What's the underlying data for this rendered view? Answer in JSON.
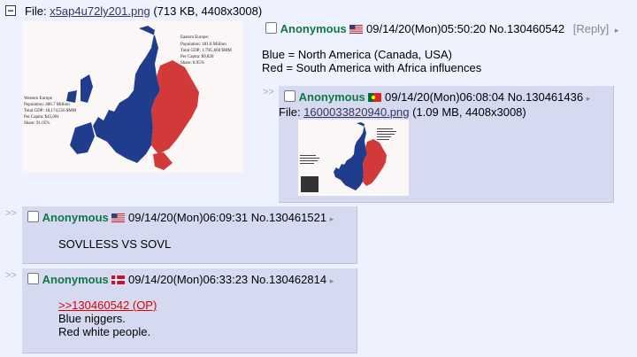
{
  "op": {
    "file_label": "File:",
    "file_name": "x5ap4u72ly201.png",
    "file_info": "(713 KB, 4408x3008)",
    "name": "Anonymous",
    "datetime": "09/14/20(Mon)05:50:20",
    "post_no": "No.130460542",
    "reply_link": "[Reply]",
    "body_lines": [
      "Blue = North America (Canada, USA)",
      "Red = South America with Africa influences"
    ],
    "map_text": {
      "east_title": "Eastern Europe:",
      "east_lines": [
        "Population: 181.8 Million",
        "Total GDP: 1.79G,660 $MM",
        "Per Capita: $9,820",
        "Share: 8.95%"
      ],
      "west_title": "Western Europe",
      "west_lines": [
        "Population: 406.7 Million",
        "Total GDP: 18,174,556 $MM",
        "Per Capita: $45,001",
        "Share: 91.05%"
      ]
    }
  },
  "replies": [
    {
      "name": "Anonymous",
      "flag": "portugal-flag-icon",
      "datetime": "09/14/20(Mon)06:08:04",
      "post_no": "No.130461436",
      "file_label": "File:",
      "file_name": "1600033820940.png",
      "file_info": "(1.09 MB, 4408x3008)"
    },
    {
      "name": "Anonymous",
      "flag": "usa-flag-icon",
      "datetime": "09/14/20(Mon)06:09:31",
      "post_no": "No.130461521",
      "body": "SOVLLESS VS SOVL"
    },
    {
      "name": "Anonymous",
      "flag": "denmark-flag-icon",
      "datetime": "09/14/20(Mon)06:33:23",
      "post_no": "No.130462814",
      "quote": ">>130460542 (OP)",
      "body_lines": [
        "Blue niggers.",
        "Red white people."
      ]
    }
  ],
  "side_arrows": ">>",
  "colors": {
    "west_blue": "#1f3d8c",
    "east_red": "#d23a3a",
    "name_green": "#117743",
    "quote_red": "#dd0000"
  }
}
